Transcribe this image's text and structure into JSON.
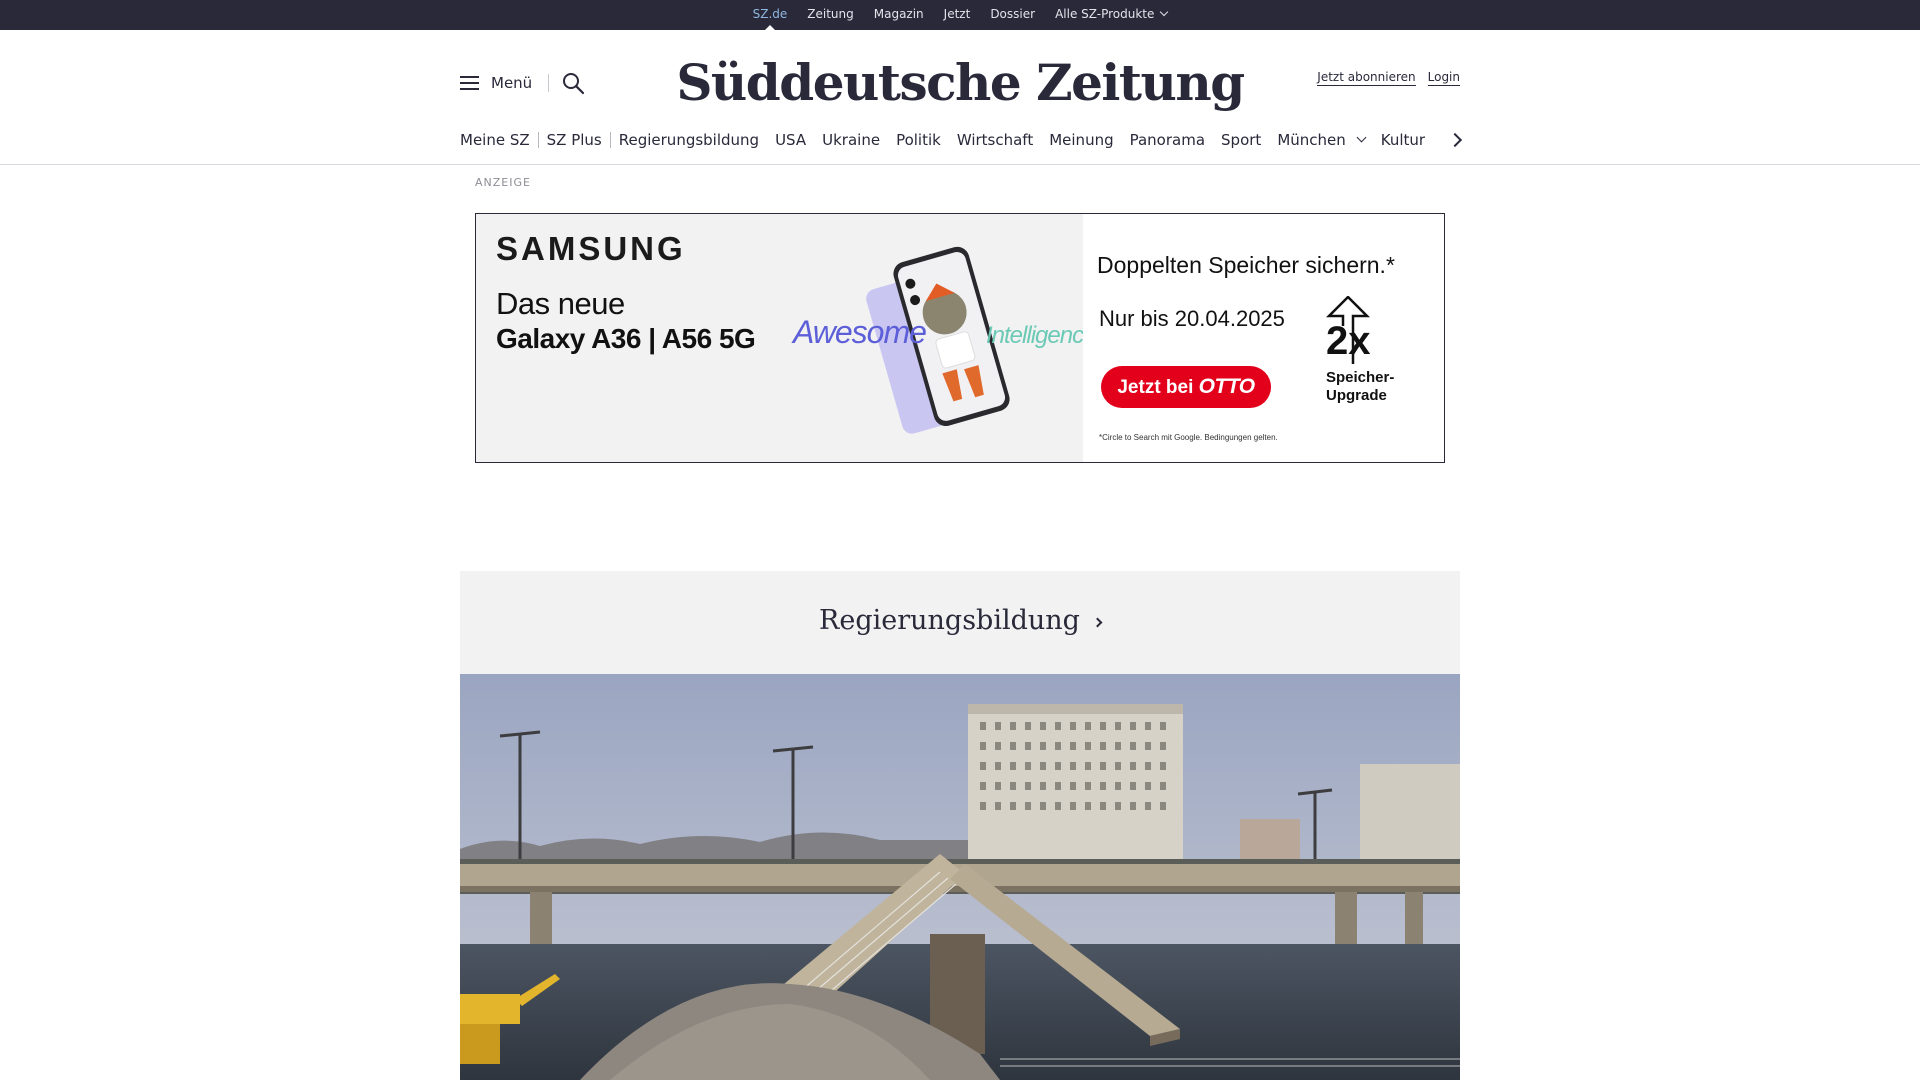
{
  "topbar": {
    "items": [
      "SZ.de",
      "Zeitung",
      "Magazin",
      "Jetzt",
      "Dossier",
      "Alle SZ-Produkte"
    ],
    "active": "SZ.de"
  },
  "header": {
    "menu_label": "Menü",
    "logo": "Süddeutsche Zeitung",
    "subscribe_label": "Jetzt abonnieren",
    "login_label": "Login"
  },
  "section_nav": {
    "items": [
      "Meine SZ",
      "SZ Plus",
      "Regierungsbildung",
      "USA",
      "Ukraine",
      "Politik",
      "Wirtschaft",
      "Meinung",
      "Panorama",
      "Sport",
      "München",
      "Kultur"
    ]
  },
  "ad": {
    "label": "ANZEIGE",
    "brand": "SAMSUNG",
    "headline_line1": "Das neue",
    "headline_line2": "Galaxy A36 | A56 5G",
    "awesome_text": "Awesome",
    "intelligence_text": "Intelligence",
    "claim": "Doppelten Speicher sichern.*",
    "date_text": "Nur bis 20.04.2025",
    "cta_prefix": "Jetzt bei ",
    "cta_brand": "OTTO",
    "upgrade_value": "2x",
    "upgrade_label": "Speicher-Upgrade",
    "fine_print": "*Circle to Search mit Google. Bedingungen gelten.",
    "colors": {
      "otto_red": "#e3001b",
      "awesome": "#5d5fd8",
      "intelligence": "#6bc9b6"
    }
  },
  "teaser": {
    "heading": "Regierungsbildung"
  },
  "colors": {
    "topbar_bg": "#29293a",
    "text": "#29293a",
    "active_link": "#8fb8e0",
    "teaser_bg": "#f2f2f2"
  }
}
